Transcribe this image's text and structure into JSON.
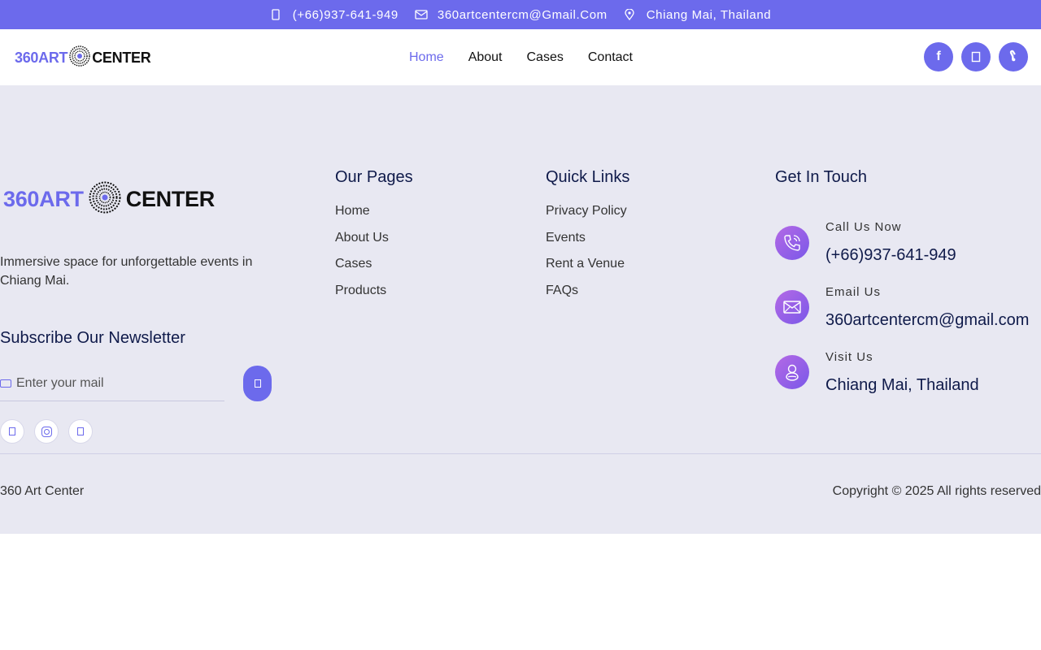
{
  "topbar": {
    "phone": "(+66)937-641-949",
    "email": "360artcentercm@Gmail.Com",
    "location": "Chiang Mai, Thailand",
    "phone_icon": "phone-icon",
    "email_icon": "mail-icon",
    "location_icon": "location-icon"
  },
  "header": {
    "logo_part1": "360ART",
    "logo_part2": "CENTER",
    "nav": [
      "Home",
      "About",
      "Cases",
      "Contact"
    ],
    "social_icons": [
      "facebook-icon",
      "instagram-icon",
      "line-icon"
    ],
    "facebook_glyph": "f",
    "line_glyph": "ໂ"
  },
  "brand": {
    "logo_part1": "360ART",
    "logo_part2": "CENTER",
    "description": "Immersive space for unforgettable events in Chiang Mai."
  },
  "newsletter": {
    "title": "Subscribe Our Newsletter",
    "placeholder": "Enter your mail"
  },
  "pages": {
    "heading": "Our Pages",
    "links": [
      "Home",
      "About Us",
      "Cases",
      "Products"
    ]
  },
  "quick": {
    "heading": "Quick Links",
    "links": [
      "Privacy Policy",
      "Events",
      "Rent a Venue",
      "FAQs"
    ]
  },
  "touch": {
    "heading": "Get In Touch",
    "items": [
      {
        "label": "Call Us Now",
        "value": "(+66)937-641-949",
        "icon": "phone-icon"
      },
      {
        "label": "Email Us",
        "value": "360artcentercm@gmail.com",
        "icon": "envelope-icon"
      },
      {
        "label": "Visit Us",
        "value": "Chiang Mai, Thailand",
        "icon": "location-icon"
      }
    ]
  },
  "bottom": {
    "left": "360 Art Center",
    "right": "Copyright © 2025 All rights reserved"
  },
  "colors": {
    "accent": "#6c6aec",
    "footer_bg": "#e8e8f2",
    "heading": "#0f1a4a"
  }
}
